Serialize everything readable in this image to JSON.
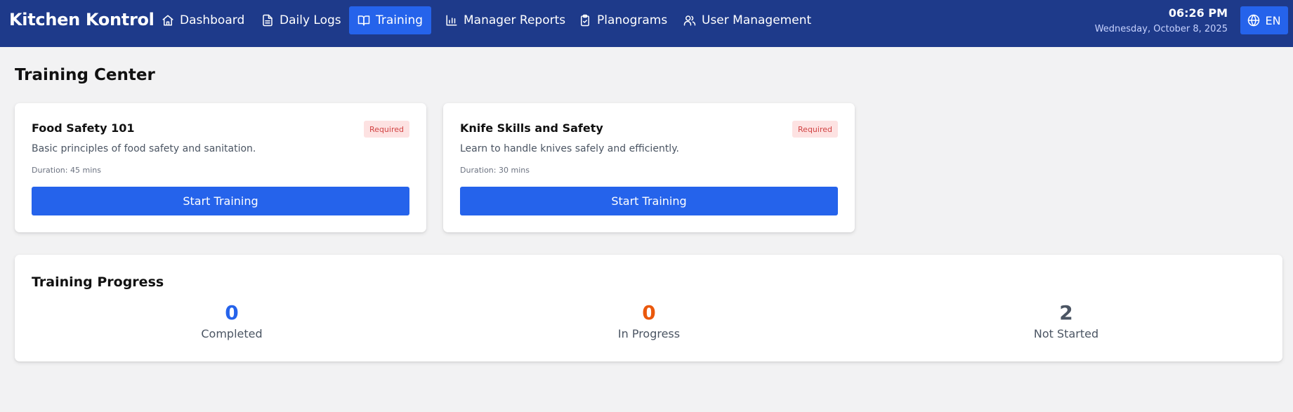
{
  "app": {
    "brand": "Kitchen Kontrol"
  },
  "nav": {
    "items": [
      {
        "label": "Dashboard",
        "icon": "home-icon",
        "active": false
      },
      {
        "label": "Daily Logs",
        "icon": "file-text-icon",
        "active": false
      },
      {
        "label": "Training",
        "icon": "book-open-icon",
        "active": true
      },
      {
        "label": "Manager Reports",
        "icon": "bar-chart-icon",
        "active": false
      },
      {
        "label": "Planograms",
        "icon": "clipboard-check-icon",
        "active": false
      },
      {
        "label": "User Management",
        "icon": "users-icon",
        "active": false
      }
    ]
  },
  "clock": {
    "time": "06:26 PM",
    "date": "Wednesday, October 8, 2025"
  },
  "language": {
    "label": "EN",
    "icon": "globe-icon"
  },
  "page": {
    "title": "Training Center"
  },
  "courses": [
    {
      "title": "Food Safety 101",
      "badge": "Required",
      "description": "Basic principles of food safety and sanitation.",
      "duration": "Duration: 45 mins",
      "button": "Start Training"
    },
    {
      "title": "Knife Skills and Safety",
      "badge": "Required",
      "description": "Learn to handle knives safely and efficiently.",
      "duration": "Duration: 30 mins",
      "button": "Start Training"
    }
  ],
  "progress": {
    "title": "Training Progress",
    "stats": [
      {
        "value": "0",
        "label": "Completed",
        "color": "#2563eb"
      },
      {
        "value": "0",
        "label": "In Progress",
        "color": "#ea580c"
      },
      {
        "value": "2",
        "label": "Not Started",
        "color": "#4b5563"
      }
    ]
  },
  "colors": {
    "navbar": "#1e3a8a",
    "accent": "#2563eb",
    "badge_bg": "#fde2e2",
    "badge_text": "#d14343",
    "page_bg": "#f2f2f3"
  }
}
